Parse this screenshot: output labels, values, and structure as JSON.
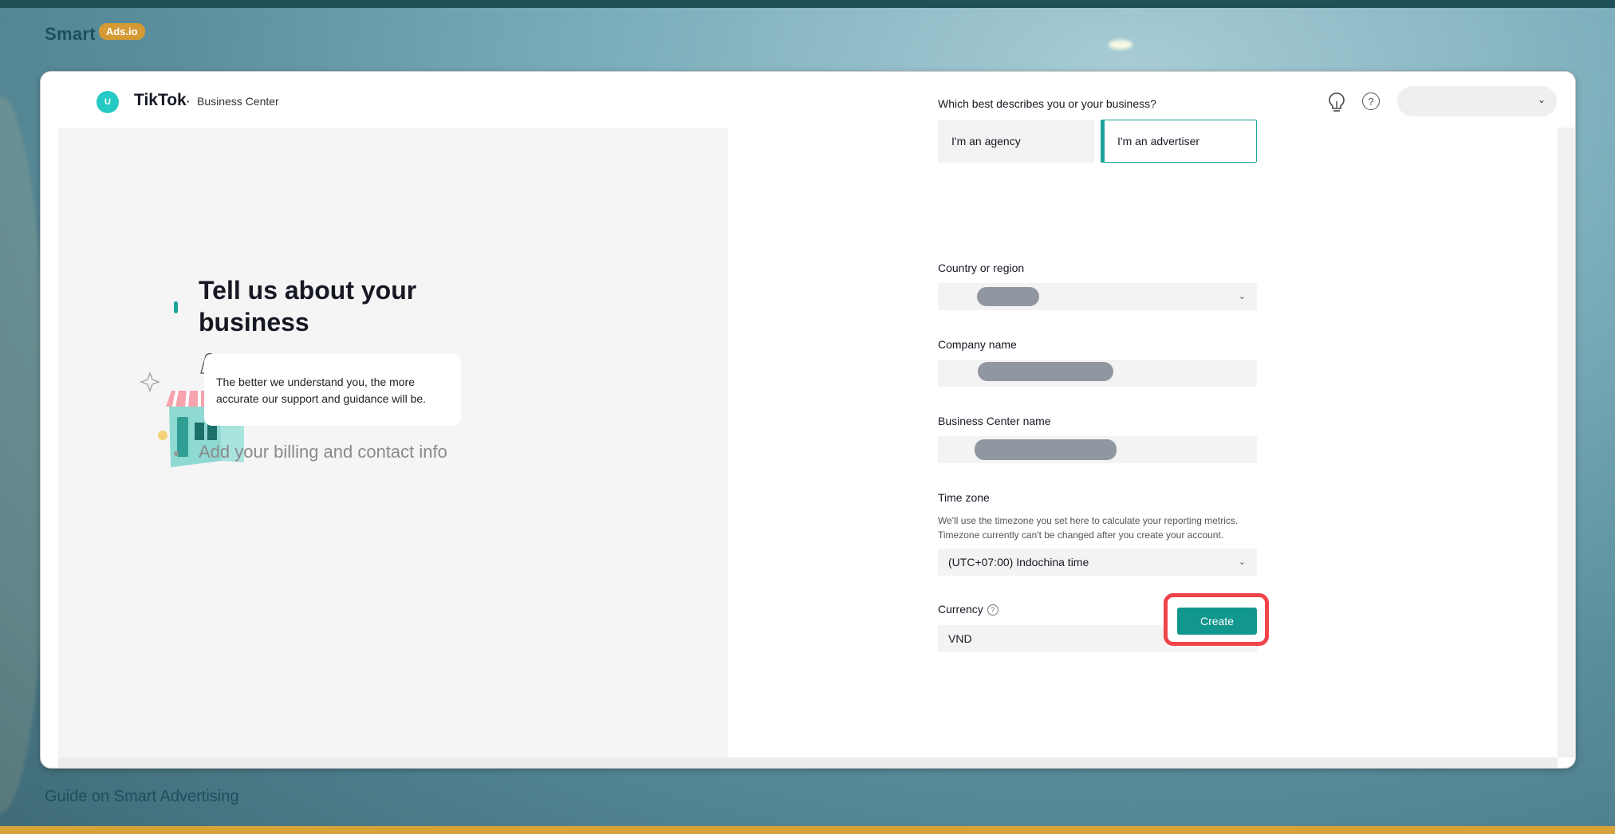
{
  "page": {
    "brand_name": "Smart",
    "brand_badge": "Ads.io",
    "footer_text": "Guide on Smart Advertising"
  },
  "header": {
    "avatar_letter": "U",
    "logo_text": "TikTok",
    "logo_suffix": "Business Center",
    "icons": [
      "lightbulb-icon",
      "help-icon",
      "chevron-down-icon"
    ]
  },
  "steps": {
    "active_title": "Tell us about your business",
    "active_description": "The better we understand you, the more accurate our support and guidance will be.",
    "next_title": "Add your billing and contact info"
  },
  "form": {
    "business_type_question": "Which best describes you or your business?",
    "business_type_options": [
      "I'm an agency",
      "I'm an advertiser"
    ],
    "business_type_selected": "I'm an advertiser",
    "country_label": "Country or region",
    "company_label": "Company name",
    "bc_name_label": "Business Center name",
    "timezone_label": "Time zone",
    "timezone_hint": "We'll use the timezone you set here to calculate your reporting metrics. Timezone currently can't be changed after you create your account.",
    "timezone_value": "(UTC+07:00) Indochina time",
    "currency_label": "Currency",
    "currency_value": "VND",
    "create_label": "Create"
  },
  "colors": {
    "accent": "#1aa39a",
    "highlight_border": "#f0444a",
    "brand_badge": "#d59a33"
  }
}
